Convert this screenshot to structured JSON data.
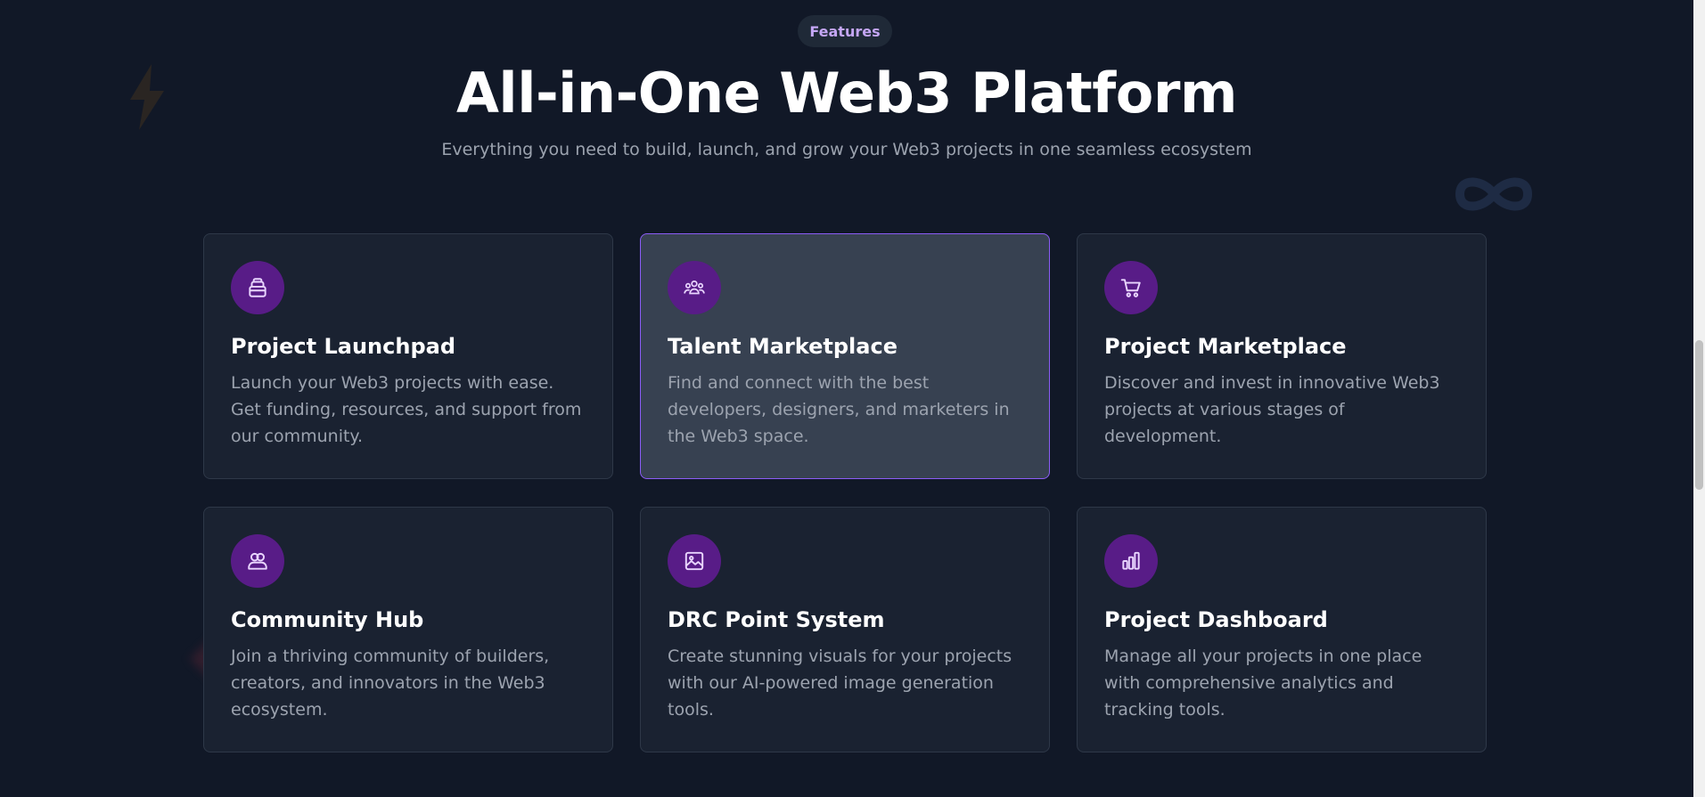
{
  "header": {
    "badge": "Features",
    "title": "All-in-One Web3 Platform",
    "subtitle": "Everything you need to build, launch, and grow your Web3 projects in one seamless ecosystem"
  },
  "colors": {
    "background": "#111827",
    "card": "#1a2231",
    "card_active": "#374151",
    "accent_border": "#8b5cf6",
    "icon_bg": "#581c87",
    "icon_fg": "#e9d5ff"
  },
  "features": [
    {
      "icon": "launchpad-icon",
      "title": "Project Launchpad",
      "description": "Launch your Web3 projects with ease. Get funding, resources, and support from our community."
    },
    {
      "icon": "people-icon",
      "title": "Talent Marketplace",
      "description": "Find and connect with the best developers, designers, and marketers in the Web3 space."
    },
    {
      "icon": "cart-icon",
      "title": "Project Marketplace",
      "description": "Discover and invest in innovative Web3 projects at various stages of development."
    },
    {
      "icon": "users-icon",
      "title": "Community Hub",
      "description": "Join a thriving community of builders, creators, and innovators in the Web3 ecosystem."
    },
    {
      "icon": "image-icon",
      "title": "DRC Point System",
      "description": "Create stunning visuals for your projects with our AI-powered image generation tools."
    },
    {
      "icon": "bar-chart-icon",
      "title": "Project Dashboard",
      "description": "Manage all your projects in one place with comprehensive analytics and tracking tools."
    }
  ]
}
